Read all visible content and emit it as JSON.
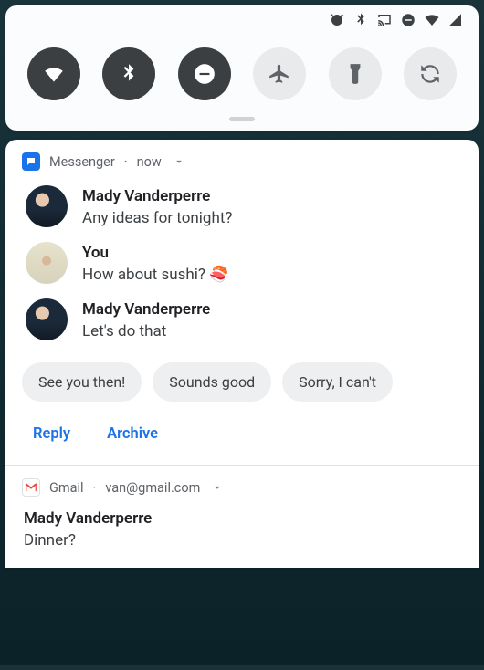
{
  "status_icons": [
    "alarm",
    "bluetooth",
    "cast",
    "dnd",
    "wifi",
    "signal"
  ],
  "quick_settings": {
    "tiles": [
      {
        "name": "wifi",
        "on": true
      },
      {
        "name": "bluetooth",
        "on": true
      },
      {
        "name": "dnd",
        "on": true
      },
      {
        "name": "airplane",
        "on": false
      },
      {
        "name": "flashlight",
        "on": false
      },
      {
        "name": "rotation",
        "on": false
      }
    ]
  },
  "notifications": [
    {
      "app": "Messenger",
      "app_icon": "messenger",
      "time": "now",
      "messages": [
        {
          "sender": "Mady Vanderperre",
          "avatar": "mady",
          "text": "Any ideas for tonight?"
        },
        {
          "sender": "You",
          "avatar": "you",
          "text": "How about sushi? 🍣"
        },
        {
          "sender": "Mady Vanderperre",
          "avatar": "mady",
          "text": "Let's do that"
        }
      ],
      "smart_replies": [
        "See you then!",
        "Sounds good",
        "Sorry, I can't"
      ],
      "actions": [
        "Reply",
        "Archive"
      ]
    },
    {
      "app": "Gmail",
      "app_icon": "gmail",
      "account": "van@gmail.com",
      "sender": "Mady Vanderperre",
      "subject": "Dinner?"
    }
  ]
}
